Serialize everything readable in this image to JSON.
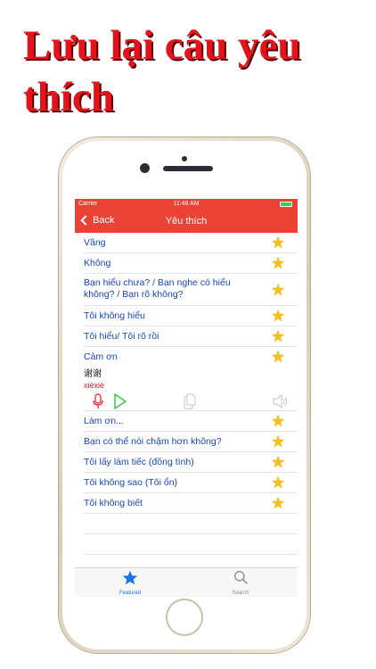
{
  "headline": "Lưu lại câu yêu thích",
  "status_bar": {
    "carrier": "Carrier",
    "time": "11:48 AM"
  },
  "nav": {
    "back_label": "Back",
    "title": "Yêu thích"
  },
  "favorites": [
    {
      "text": "Vâng"
    },
    {
      "text": "Không"
    },
    {
      "text": "Bạn hiểu chưa? / Bạn nghe có hiểu không? / Bạn rõ không?"
    },
    {
      "text": "Tôi không hiểu"
    },
    {
      "text": "Tôi hiểu/ Tôi rõ rồi"
    },
    {
      "text": "Cảm ơn",
      "chinese": "谢谢",
      "pinyin": "xièxiè"
    },
    {
      "text": "Làm ơn..."
    },
    {
      "text": "Bạn có thể nói chậm hơn không?"
    },
    {
      "text": "Tôi lấy làm tiếc (đồng tình)"
    },
    {
      "text": "Tôi không sao (Tôi ổn)"
    },
    {
      "text": "Tôi không biết"
    }
  ],
  "tabs": [
    {
      "label": "Featured",
      "icon": "star-icon",
      "color": "#1a73e8"
    },
    {
      "label": "Search",
      "icon": "search-icon",
      "color": "#8e8e93"
    }
  ],
  "colors": {
    "accent": "#ea4335",
    "headline": "#e3121b",
    "link": "#1746b8",
    "star": "#f2c21a"
  }
}
